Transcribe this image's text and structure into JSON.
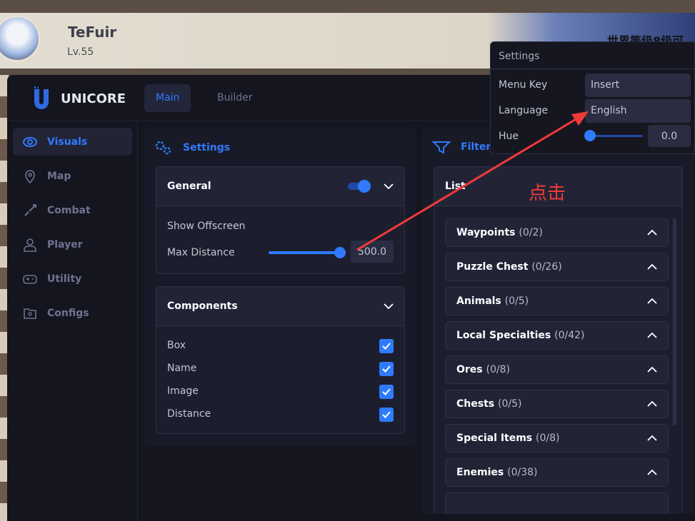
{
  "game": {
    "player_name": "TeFuir",
    "level": "Lv.55",
    "banner_text": "世界等级8级可"
  },
  "app": {
    "brand": "UNICORE",
    "accent": "#2f7bff"
  },
  "tabs": [
    {
      "label": "Main",
      "active": true
    },
    {
      "label": "Builder",
      "active": false
    }
  ],
  "sidebar": {
    "items": [
      {
        "label": "Visuals",
        "icon": "eye-icon",
        "active": true
      },
      {
        "label": "Map",
        "icon": "map-pin-icon"
      },
      {
        "label": "Combat",
        "icon": "sword-icon"
      },
      {
        "label": "Player",
        "icon": "user-icon"
      },
      {
        "label": "Utility",
        "icon": "gamepad-icon"
      },
      {
        "label": "Configs",
        "icon": "folder-gear-icon"
      }
    ]
  },
  "settings_panel": {
    "title": "Settings",
    "general": {
      "title": "General",
      "enabled": true,
      "show_offscreen_label": "Show Offscreen",
      "show_offscreen": true,
      "max_distance_label": "Max Distance",
      "max_distance": "500.0",
      "max_distance_fraction": 1.0
    },
    "components": {
      "title": "Components",
      "items": [
        {
          "label": "Box",
          "checked": true
        },
        {
          "label": "Name",
          "checked": true
        },
        {
          "label": "Image",
          "checked": true
        },
        {
          "label": "Distance",
          "checked": true
        }
      ]
    }
  },
  "filters_panel": {
    "title": "Filters",
    "list_title": "List",
    "items": [
      {
        "name": "Waypoints",
        "count": "(0/2)"
      },
      {
        "name": "Puzzle Chest",
        "count": "(0/26)"
      },
      {
        "name": "Animals",
        "count": "(0/5)"
      },
      {
        "name": "Local Specialties",
        "count": "(0/42)"
      },
      {
        "name": "Ores",
        "count": "(0/8)"
      },
      {
        "name": "Chests",
        "count": "(0/5)"
      },
      {
        "name": "Special Items",
        "count": "(0/8)"
      },
      {
        "name": "Enemies",
        "count": "(0/38)"
      }
    ]
  },
  "popup": {
    "title": "Settings",
    "menu_key_label": "Menu Key",
    "menu_key": "Insert",
    "language_label": "Language",
    "language": "English",
    "hue_label": "Hue",
    "hue": "0.0",
    "hue_fraction": 0.0
  },
  "annotation": {
    "text": "点击",
    "color": "#f03a3a"
  }
}
